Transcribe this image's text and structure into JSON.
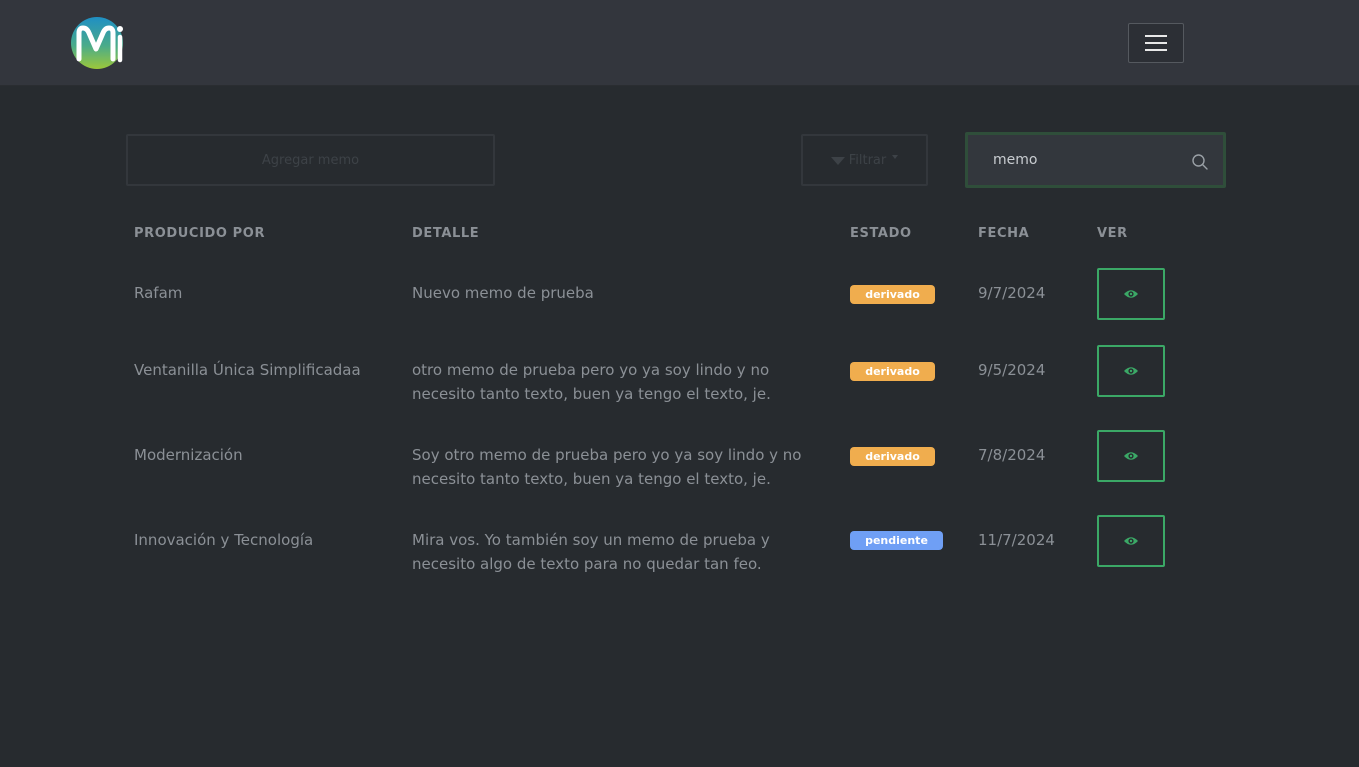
{
  "header": {
    "logo_text": "Mi",
    "menu_icon": "hamburger-icon"
  },
  "toolbar": {
    "add_label": "Agregar memo",
    "filter_label": "Filtrar",
    "filter_icon": "funnel-icon",
    "search_value": "memo",
    "search_icon": "search-icon"
  },
  "table": {
    "columns": [
      "PRODUCIDO POR",
      "DETALLE",
      "ESTADO",
      "FECHA",
      "VER"
    ],
    "rows": [
      {
        "producer": "Rafam",
        "detail_lines": [
          "Nuevo memo de prueba"
        ],
        "status": "derivado",
        "status_color": "#f0ad4e",
        "date": "9/7/2024"
      },
      {
        "producer": "Ventanilla Única Simplificadaa",
        "detail_lines": [
          "otro memo de prueba pero yo ya soy lindo y no",
          "necesito tanto texto, buen ya tengo el texto, je."
        ],
        "status": "derivado",
        "status_color": "#f0ad4e",
        "date": "9/5/2024"
      },
      {
        "producer": "Modernización",
        "detail_lines": [
          "Soy otro memo de prueba pero yo ya soy lindo y no",
          "necesito tanto texto, buen ya tengo el texto, je."
        ],
        "status": "derivado",
        "status_color": "#f0ad4e",
        "date": "7/8/2024"
      },
      {
        "producer": "Innovación y Tecnología",
        "detail_lines": [
          "Mira vos. Yo también soy un memo de prueba y",
          "necesito algo de texto para no quedar tan feo."
        ],
        "status": "pendiente",
        "status_color": "#6f9ff5",
        "date": "11/7/2024"
      }
    ]
  },
  "colors": {
    "accent_green": "#3ba866",
    "background": "#272b2f",
    "header_bg": "#33363d"
  }
}
